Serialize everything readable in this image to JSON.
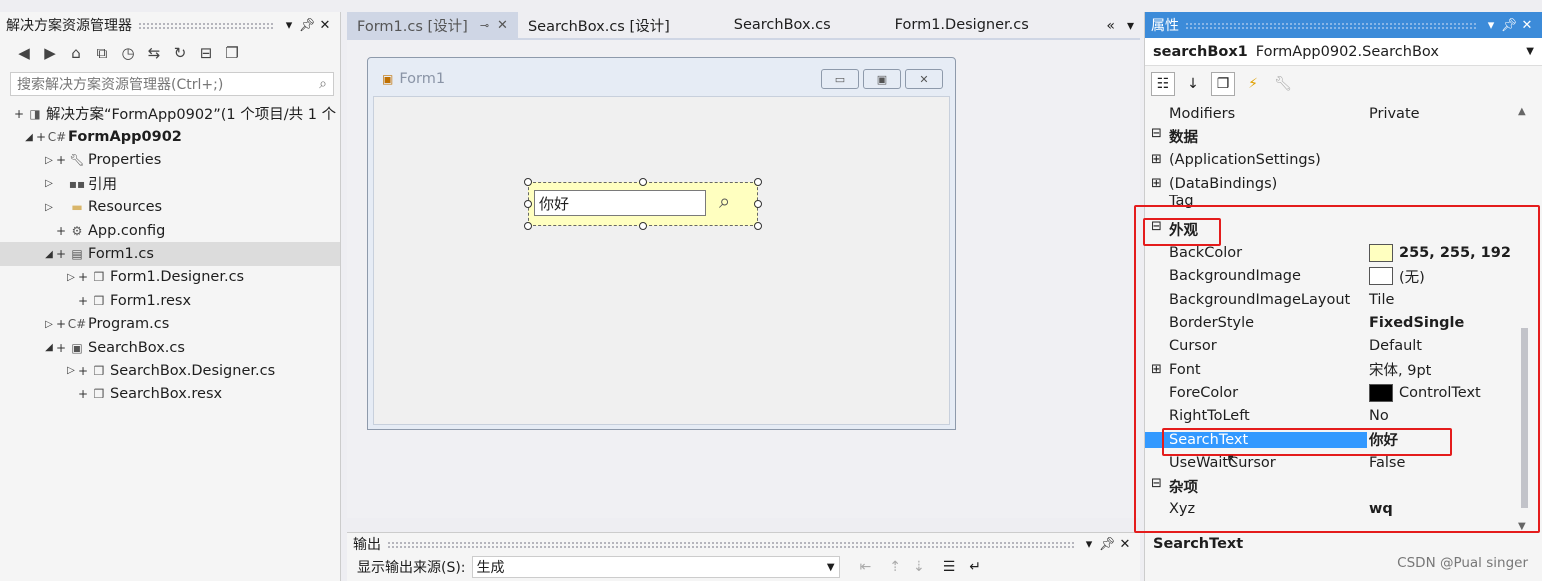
{
  "solution_explorer": {
    "title": "解决方案资源管理器",
    "search_placeholder": "搜索解决方案资源管理器(Ctrl+;)",
    "items": [
      {
        "label": "解决方案“FormApp0902”(1 个项目/共 1 个",
        "bold": false
      },
      {
        "label": "FormApp0902",
        "bold": true
      },
      {
        "label": "Properties"
      },
      {
        "label": "引用"
      },
      {
        "label": "Resources"
      },
      {
        "label": "App.config"
      },
      {
        "label": "Form1.cs"
      },
      {
        "label": "Form1.Designer.cs"
      },
      {
        "label": "Form1.resx"
      },
      {
        "label": "Program.cs"
      },
      {
        "label": "SearchBox.cs"
      },
      {
        "label": "SearchBox.Designer.cs"
      },
      {
        "label": "SearchBox.resx"
      }
    ]
  },
  "tabs": [
    {
      "label": "Form1.cs [设计]"
    },
    {
      "label": "SearchBox.cs [设计]"
    },
    {
      "label": "SearchBox.cs"
    },
    {
      "label": "Form1.Designer.cs"
    }
  ],
  "designer": {
    "form_title": "Form1",
    "search_text": "你好"
  },
  "output": {
    "title": "输出",
    "source_label": "显示输出来源(S):",
    "source_value": "生成"
  },
  "properties": {
    "title": "属性",
    "object_name": "searchBox1",
    "object_type": "FormApp0902.SearchBox",
    "rows": [
      {
        "name": "Modifiers",
        "value": "Private"
      },
      {
        "name": "数据",
        "value": ""
      },
      {
        "name": "(ApplicationSettings)",
        "value": ""
      },
      {
        "name": "(DataBindings)",
        "value": ""
      },
      {
        "name": "Tag",
        "value": ""
      },
      {
        "name": "外观",
        "value": ""
      },
      {
        "name": "BackColor",
        "value": "255, 255, 192"
      },
      {
        "name": "BackgroundImage",
        "value": "(无)"
      },
      {
        "name": "BackgroundImageLayout",
        "value": "Tile"
      },
      {
        "name": "BorderStyle",
        "value": "FixedSingle"
      },
      {
        "name": "Cursor",
        "value": "Default"
      },
      {
        "name": "Font",
        "value": "宋体, 9pt"
      },
      {
        "name": "ForeColor",
        "value": "ControlText"
      },
      {
        "name": "RightToLeft",
        "value": "No"
      },
      {
        "name": "SearchText",
        "value": "你好"
      },
      {
        "name": "UseWaitCursor",
        "value": "False"
      },
      {
        "name": "杂项",
        "value": ""
      },
      {
        "name": "Xyz",
        "value": "wq"
      }
    ],
    "description_title": "SearchText"
  },
  "colors": {
    "accent": "#3c8bd9",
    "backcolor_swatch": "#ffffc0",
    "highlight_box": "#e41c1c",
    "selection": "#3399ff"
  },
  "watermark": "CSDN @Pual singer"
}
